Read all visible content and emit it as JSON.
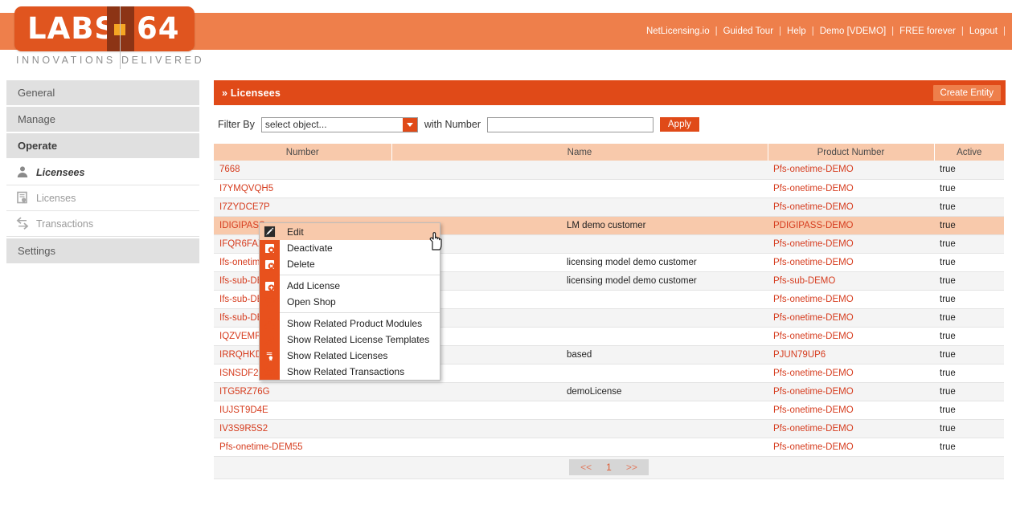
{
  "brand": {
    "logo_main": "LABS",
    "logo_secondary": "64",
    "tagline": "INNOVATIONS DELIVERED",
    "accent_orange": "#ee7f4b",
    "accent_red": "#e04a18",
    "logo_box": "#e0551f",
    "logo_square": "#8c3415",
    "logo_dot": "#f5a623",
    "table_header": "#f8c9ab",
    "link_red": "#d63c1e"
  },
  "topnav": {
    "separator": "|",
    "links": [
      {
        "label": "NetLicensing.io"
      },
      {
        "label": "Guided Tour"
      },
      {
        "label": "Help"
      },
      {
        "label": "Demo [VDEMO]"
      },
      {
        "label": "FREE forever"
      },
      {
        "label": "Logout"
      }
    ]
  },
  "sidebar": {
    "groups": [
      {
        "label": "General",
        "active": false
      },
      {
        "label": "Manage",
        "active": false
      },
      {
        "label": "Operate",
        "active": true
      },
      {
        "label": "Settings",
        "active": false
      }
    ],
    "items": [
      {
        "label": "Licensees",
        "icon": "licensee-icon",
        "selected": true
      },
      {
        "label": "Licenses",
        "icon": "license-icon",
        "selected": false
      },
      {
        "label": "Transactions",
        "icon": "transactions-icon",
        "selected": false
      }
    ]
  },
  "page": {
    "breadcrumb": "» Licensees",
    "create_button": "Create Entity"
  },
  "filter": {
    "label": "Filter By",
    "select_value": "select object...",
    "with_number_label": "with Number",
    "number_value": "",
    "number_placeholder": "",
    "apply_label": "Apply"
  },
  "table": {
    "columns": [
      "Number",
      "Name",
      "Product Number",
      "Active"
    ],
    "rows": [
      {
        "number": "7668",
        "name": "",
        "product": "Pfs-onetime-DEMO",
        "active": "true",
        "hl": false
      },
      {
        "number": "I7YMQVQH5",
        "name": "",
        "product": "Pfs-onetime-DEMO",
        "active": "true",
        "hl": false
      },
      {
        "number": "I7ZYDCE7P",
        "name": "",
        "product": "Pfs-onetime-DEMO",
        "active": "true",
        "hl": false
      },
      {
        "number": "IDIGIPASS-",
        "name": "LM demo customer",
        "product": "PDIGIPASS-DEMO",
        "active": "true",
        "hl": true
      },
      {
        "number": "IFQR6FAX",
        "name": "",
        "product": "Pfs-onetime-DEMO",
        "active": "true",
        "hl": false
      },
      {
        "number": "Ifs-onetim",
        "name": "licensing model demo customer",
        "product": "Pfs-onetime-DEMO",
        "active": "true",
        "hl": false
      },
      {
        "number": "Ifs-sub-DE",
        "name": "licensing model demo customer",
        "product": "Pfs-sub-DEMO",
        "active": "true",
        "hl": false
      },
      {
        "number": "Ifs-sub-DE",
        "name": "",
        "product": "Pfs-onetime-DEMO",
        "active": "true",
        "hl": false
      },
      {
        "number": "Ifs-sub-DE",
        "name": "",
        "product": "Pfs-onetime-DEMO",
        "active": "true",
        "hl": false
      },
      {
        "number": "IQZVEMR0",
        "name": "",
        "product": "Pfs-onetime-DEMO",
        "active": "true",
        "hl": false
      },
      {
        "number": "IRRQHKD3",
        "name": "based",
        "product": "PJUN79UP6",
        "active": "true",
        "hl": false
      },
      {
        "number": "ISNSDF2R",
        "name": "",
        "product": "Pfs-onetime-DEMO",
        "active": "true",
        "hl": false
      },
      {
        "number": "ITG5RZ76G",
        "name": "demoLicense",
        "product": "Pfs-onetime-DEMO",
        "active": "true",
        "hl": false
      },
      {
        "number": "IUJST9D4E",
        "name": "",
        "product": "Pfs-onetime-DEMO",
        "active": "true",
        "hl": false
      },
      {
        "number": "IV3S9R5S2",
        "name": "",
        "product": "Pfs-onetime-DEMO",
        "active": "true",
        "hl": false
      },
      {
        "number": "Pfs-onetime-DEM55",
        "name": "",
        "product": "Pfs-onetime-DEMO",
        "active": "true",
        "hl": false
      }
    ]
  },
  "pager": {
    "prev": "<<",
    "current": "1",
    "next": ">>"
  },
  "context_menu": {
    "items": [
      {
        "label": "Edit",
        "icon": "edit-pencil-icon",
        "highlighted": true
      },
      {
        "label": "Deactivate",
        "icon": "deactivate-icon",
        "highlighted": false
      },
      {
        "label": "Delete",
        "icon": "delete-icon",
        "highlighted": false
      },
      {
        "label": "Add License",
        "icon": "add-license-icon",
        "highlighted": false
      },
      {
        "label": "Open Shop",
        "icon": "shopping-cart-icon",
        "highlighted": false
      },
      {
        "label": "Show Related Product Modules",
        "icon": "product-modules-icon",
        "highlighted": false
      },
      {
        "label": "Show Related License Templates",
        "icon": "license-templates-icon",
        "highlighted": false
      },
      {
        "label": "Show Related Licenses",
        "icon": "related-licenses-icon",
        "highlighted": false
      },
      {
        "label": "Show Related Transactions",
        "icon": "related-transactions-icon",
        "highlighted": false
      }
    ]
  }
}
